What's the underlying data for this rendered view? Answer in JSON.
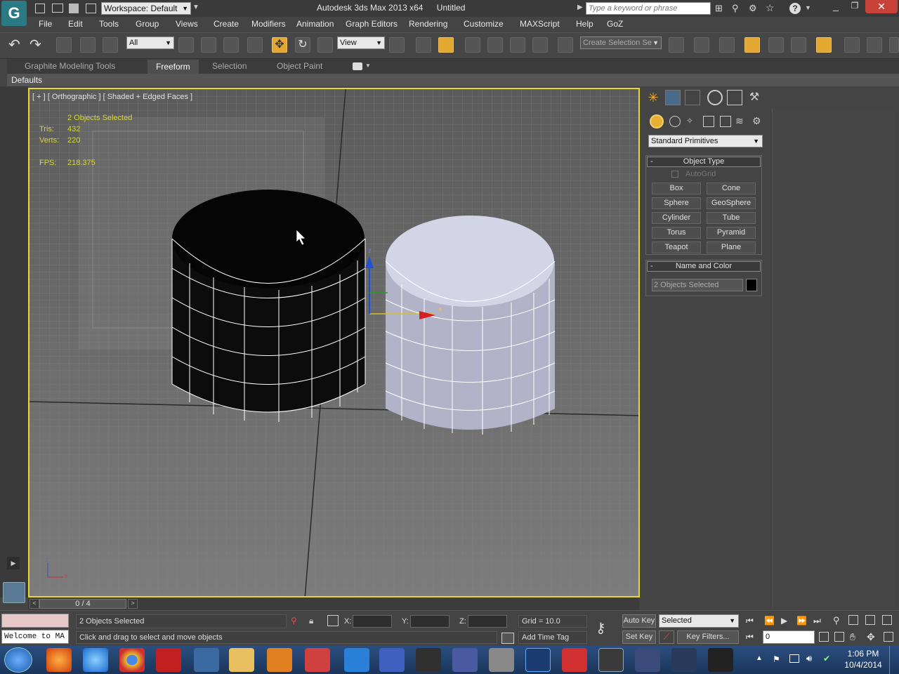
{
  "titlebar": {
    "workspace": "Workspace: Default",
    "title": "Autodesk 3ds Max 2013 x64",
    "file": "Untitled",
    "search_placeholder": "Type a keyword or phrase"
  },
  "menu": [
    "File",
    "Edit",
    "Tools",
    "Group",
    "Views",
    "Create",
    "Modifiers",
    "Animation",
    "Graph Editors",
    "Rendering",
    "Customize",
    "MAXScript",
    "Help",
    "GoZ"
  ],
  "toolbar": {
    "filter_value": "All",
    "refcoord_value": "View",
    "selection_set_placeholder": "Create Selection Se"
  },
  "ribbon": {
    "tabs": [
      "Graphite Modeling Tools",
      "Freeform",
      "Selection",
      "Object Paint"
    ],
    "active_tab": "Freeform",
    "defaults_label": "Defaults"
  },
  "viewport": {
    "label": "[ + ] [ Orthographic ] [ Shaded + Edged Faces ]",
    "selected_info": "2 Objects Selected",
    "tris_label": "Tris:",
    "tris_value": "432",
    "verts_label": "Verts:",
    "verts_value": "220",
    "fps_label": "FPS:",
    "fps_value": "218.375",
    "gizmo_x": "x",
    "gizmo_z": "z",
    "axis_x": "x",
    "axis_z": "z"
  },
  "command_panel": {
    "category": "Standard Primitives",
    "object_type_title": "Object Type",
    "autogrid_label": "AutoGrid",
    "buttons": [
      "Box",
      "Cone",
      "Sphere",
      "GeoSphere",
      "Cylinder",
      "Tube",
      "Torus",
      "Pyramid",
      "Teapot",
      "Plane"
    ],
    "name_color_title": "Name and Color",
    "name_value": "2 Objects Selected",
    "color": "#000000"
  },
  "timeline": {
    "frame_display": "0 / 4"
  },
  "statusbar": {
    "maxscript_text": "Welcome to MA",
    "selection_text": "2 Objects Selected",
    "prompt": "Click and drag to select and move objects",
    "x_label": "X:",
    "y_label": "Y:",
    "z_label": "Z:",
    "grid": "Grid = 10.0",
    "add_time_tag": "Add Time Tag",
    "auto_key": "Auto Key",
    "set_key": "Set Key",
    "key_filters": "Key Filters...",
    "selected_dropdown": "Selected",
    "frame_value": "0"
  },
  "taskbar": {
    "time": "1:06 PM",
    "date": "10/4/2014"
  },
  "colors": {
    "accent": "#e2a832",
    "viewport_border": "#e6d632",
    "hud_text": "#d6d63a"
  }
}
